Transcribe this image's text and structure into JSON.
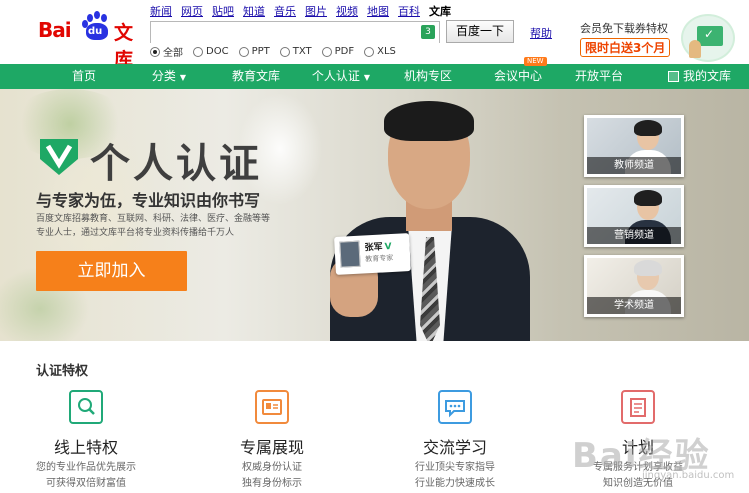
{
  "header": {
    "logo_text_latin": "Bai",
    "logo_paw_text": "du",
    "logo_text_cn": "文库",
    "topnav": [
      "新闻",
      "网页",
      "贴吧",
      "知道",
      "音乐",
      "图片",
      "视频",
      "地图",
      "百科",
      "文库"
    ],
    "topnav_current_index": 9,
    "search": {
      "value": "",
      "badge": "3"
    },
    "search_button": "百度一下",
    "help_link": "帮助",
    "filetypes": [
      {
        "label": "全部",
        "selected": true
      },
      {
        "label": "DOC",
        "selected": false
      },
      {
        "label": "PPT",
        "selected": false
      },
      {
        "label": "TXT",
        "selected": false
      },
      {
        "label": "PDF",
        "selected": false
      },
      {
        "label": "XLS",
        "selected": false
      }
    ],
    "promo": {
      "line1": "会员免下载券特权",
      "line2": "限时白送3个月"
    }
  },
  "mainnav": {
    "items": [
      {
        "label": "首页",
        "caret": false
      },
      {
        "label": "分类",
        "caret": true
      },
      {
        "label": "教育文库",
        "caret": false
      },
      {
        "label": "个人认证",
        "caret": true
      },
      {
        "label": "机构专区",
        "caret": false
      },
      {
        "label": "会议中心",
        "caret": false,
        "badge": "NEW"
      },
      {
        "label": "开放平台",
        "caret": false
      }
    ],
    "my_library": "我的文库",
    "accent": "#1ea865"
  },
  "banner": {
    "title": "个人认证",
    "subtitle": "与专家为伍，专业知识由你书写",
    "desc_line1": "百度文库招募教育、互联网、科研、法律、医疗、金融等等",
    "desc_line2": "专业人士，通过文库平台将专业资料传播给千万人",
    "join_button": "立即加入",
    "card": {
      "name": "张军",
      "role": "教育专家"
    },
    "channels": [
      "教师频道",
      "营销频道",
      "学术频道"
    ]
  },
  "privileges": {
    "title": "认证特权",
    "items": [
      {
        "name": "线上特权",
        "line1": "您的专业作品优先展示",
        "line2": "可获得双倍财富值",
        "icon": "search-icon",
        "color": "#20a978"
      },
      {
        "name": "专属展现",
        "line1": "权威身份认证",
        "line2": "独有身份标示",
        "icon": "id-card-icon",
        "color": "#f18a3c"
      },
      {
        "name": "交流学习",
        "line1": "行业顶尖专家指导",
        "line2": "行业能力快速成长",
        "icon": "chat-icon",
        "color": "#3d9be0"
      },
      {
        "name": "计划",
        "line1": "专属服务计划享收益",
        "line2": "知识创造无价值",
        "icon": "plan-icon",
        "color": "#e26b6b"
      }
    ]
  },
  "watermark": {
    "text": "Bai经验",
    "sub": "jingyan.baidu.com"
  }
}
